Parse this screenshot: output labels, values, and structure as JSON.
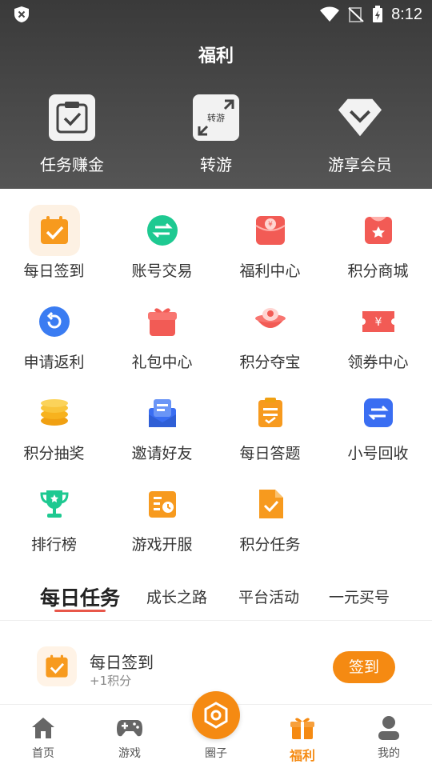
{
  "status_bar": {
    "time": "8:12"
  },
  "page": {
    "title": "福利"
  },
  "hero": [
    {
      "label": "任务赚金",
      "icon": "task-clipboard-icon"
    },
    {
      "label": "转游",
      "icon": "transfer-game-icon",
      "badge": "转游"
    },
    {
      "label": "游享会员",
      "icon": "vip-diamond-icon"
    }
  ],
  "grid": [
    {
      "label": "每日签到",
      "icon": "calendar-check-icon",
      "color": "#f79a1e"
    },
    {
      "label": "账号交易",
      "icon": "exchange-arrows-icon",
      "color": "#1ec991"
    },
    {
      "label": "福利中心",
      "icon": "red-envelope-icon",
      "color": "#f25b55"
    },
    {
      "label": "积分商城",
      "icon": "points-mall-icon",
      "color": "#f25b55"
    },
    {
      "label": "申请返利",
      "icon": "rebate-refresh-icon",
      "color": "#3a7cf2"
    },
    {
      "label": "礼包中心",
      "icon": "gift-box-icon",
      "color": "#f25b55"
    },
    {
      "label": "积分夺宝",
      "icon": "treasure-icon",
      "color": "#f25b55"
    },
    {
      "label": "领券中心",
      "icon": "coupon-icon",
      "color": "#f25b55"
    },
    {
      "label": "积分抽奖",
      "icon": "coin-stack-icon",
      "color": "#f7b21e"
    },
    {
      "label": "邀请好友",
      "icon": "invite-mail-icon",
      "color": "#3a6ef2"
    },
    {
      "label": "每日答题",
      "icon": "daily-quiz-icon",
      "color": "#f79a1e"
    },
    {
      "label": "小号回收",
      "icon": "recycle-account-icon",
      "color": "#3a6ef2"
    },
    {
      "label": "排行榜",
      "icon": "trophy-icon",
      "color": "#1ec991"
    },
    {
      "label": "游戏开服",
      "icon": "server-open-icon",
      "color": "#f79a1e"
    },
    {
      "label": "积分任务",
      "icon": "points-task-icon",
      "color": "#f79a1e"
    }
  ],
  "tabs": [
    {
      "label": "每日任务",
      "active": true
    },
    {
      "label": "成长之路"
    },
    {
      "label": "平台活动"
    },
    {
      "label": "一元买号"
    }
  ],
  "task": {
    "title": "每日签到",
    "reward": "+1积分",
    "button": "签到"
  },
  "nav": [
    {
      "label": "首页",
      "icon": "home-icon"
    },
    {
      "label": "游戏",
      "icon": "gamepad-icon"
    },
    {
      "label": "圈子",
      "icon": "circle-hexagon-icon"
    },
    {
      "label": "福利",
      "icon": "gift-icon",
      "active": true
    },
    {
      "label": "我的",
      "icon": "user-icon"
    }
  ],
  "colors": {
    "accent": "#f58a12",
    "tab_underline": "#e8574a"
  }
}
